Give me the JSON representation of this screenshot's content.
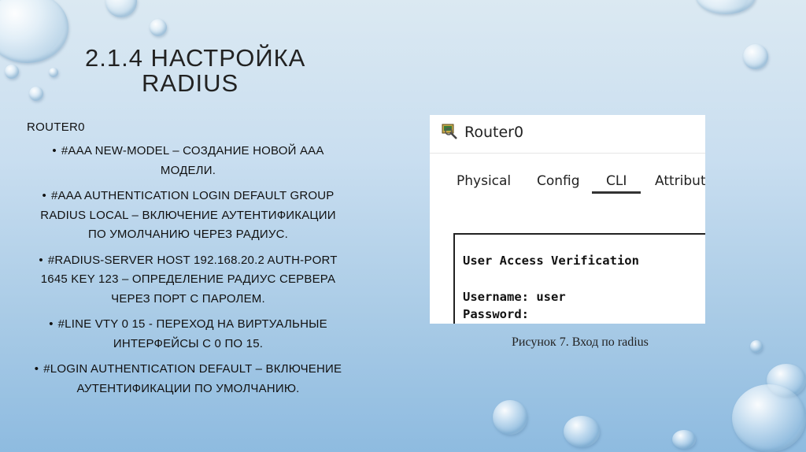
{
  "slide": {
    "title_line1": "2.1.4 НАСТРОЙКА",
    "title_line2": "RADIUS",
    "heading": "ROUTER0",
    "bullet_symbol": "•",
    "bullets": [
      {
        "l1": "#AAA NEW-MODEL – СОЗДАНИЕ НОВОЙ AAA",
        "l2": "МОДЕЛИ."
      },
      {
        "l1": "#AAA AUTHENTICATION LOGIN DEFAULT GROUP",
        "l2": "RADIUS LOCAL – ВКЛЮЧЕНИЕ АУТЕНТИФИКАЦИИ",
        "l3": "ПО УМОЛЧАНИЮ ЧЕРЕЗ РАДИУС."
      },
      {
        "l1": "#RADIUS-SERVER HOST 192.168.20.2 AUTH-PORT",
        "l2": "1645 KEY 123 – ОПРЕДЕЛЕНИЕ РАДИУС СЕРВЕРА",
        "l3": "ЧЕРЕЗ ПОРТ С ПАРОЛЕМ."
      },
      {
        "l1": "#LINE VTY 0 15 - ПЕРЕХОД НА ВИРТУАЛЬНЫЕ",
        "l2": "ИНТЕРФЕЙСЫ С 0 ПО 15."
      },
      {
        "l1": "#LOGIN AUTHENTICATION DEFAULT – ВКЛЮЧЕНИЕ",
        "l2": "АУТЕНТИФИКАЦИИ ПО УМОЛЧАНИЮ."
      }
    ],
    "caption": "Рисунок 7. Вход по radius"
  },
  "screenshot": {
    "window_title": "Router0",
    "icon": "router-icon",
    "tabs": [
      {
        "label": "Physical"
      },
      {
        "label": "Config"
      },
      {
        "label": "CLI",
        "active": true
      },
      {
        "label": "Attribute"
      }
    ],
    "console_lines": [
      "User Access Verification",
      "",
      "Username: user",
      "Password:"
    ]
  },
  "colors": {
    "text": "#111111",
    "background_top": "#dbe9f2",
    "background_bottom": "#8ebbe0"
  }
}
